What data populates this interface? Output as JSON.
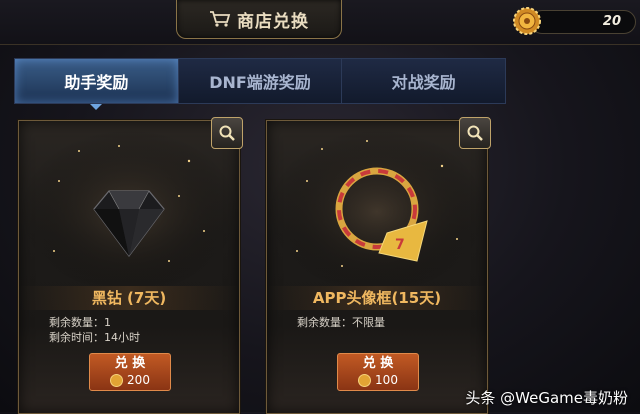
{
  "header": {
    "title": "商店兑换",
    "cart_icon": "cart-icon",
    "currency_amount": "20",
    "currency_icon": "gear-coin-icon"
  },
  "tabs": [
    {
      "label": "助手奖励",
      "active": true
    },
    {
      "label": "DNF端游奖励",
      "active": false
    },
    {
      "label": "对战奖励",
      "active": false
    }
  ],
  "items": [
    {
      "name": "黑钻 (7天)",
      "details": [
        "剩余数量：1",
        "剩余时间：14小时"
      ],
      "redeem_label": "兑 换",
      "price": "200",
      "icon": "black-diamond-icon"
    },
    {
      "name": "APP头像框(15天)",
      "details": [
        "剩余数量：不限量"
      ],
      "redeem_label": "兑 换",
      "price": "100",
      "icon": "avatar-frame-icon"
    }
  ],
  "watermark": "头条 @WeGame毒奶粉",
  "colors": {
    "accent": "#f0b860",
    "button": "#c25a24",
    "tab_active": "#3a5d88"
  }
}
